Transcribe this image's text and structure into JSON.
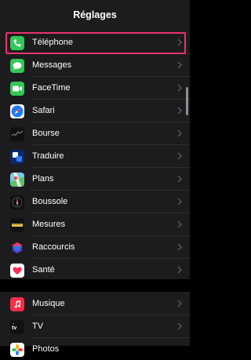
{
  "header": {
    "title": "Réglages"
  },
  "colors": {
    "highlight": "#e8336d",
    "group_bg": "#1c1c1e",
    "chevron": "#5a5a5e"
  },
  "group1": [
    {
      "label": "Téléphone",
      "icon": "phone-icon",
      "color": "#34c759"
    },
    {
      "label": "Messages",
      "icon": "messages-icon",
      "color": "#34c759"
    },
    {
      "label": "FaceTime",
      "icon": "facetime-icon",
      "color": "#34c759"
    },
    {
      "label": "Safari",
      "icon": "safari-icon",
      "color": "#1e7cf2"
    },
    {
      "label": "Bourse",
      "icon": "stocks-icon",
      "color": "#1c1c1e"
    },
    {
      "label": "Traduire",
      "icon": "translate-icon",
      "color": "#0a2a6e"
    },
    {
      "label": "Plans",
      "icon": "maps-icon",
      "color": "#5ec26a"
    },
    {
      "label": "Boussole",
      "icon": "compass-icon",
      "color": "#111111"
    },
    {
      "label": "Mesures",
      "icon": "measure-icon",
      "color": "#111111"
    },
    {
      "label": "Raccourcis",
      "icon": "shortcuts-icon",
      "color": "#5b3fd6"
    },
    {
      "label": "Santé",
      "icon": "health-icon",
      "color": "#ffffff"
    }
  ],
  "group2": [
    {
      "label": "Musique",
      "icon": "music-icon",
      "color": "#fa2d48"
    },
    {
      "label": "TV",
      "icon": "tv-icon",
      "color": "#111111"
    },
    {
      "label": "Photos",
      "icon": "photos-icon",
      "color": "#ffffff"
    }
  ]
}
